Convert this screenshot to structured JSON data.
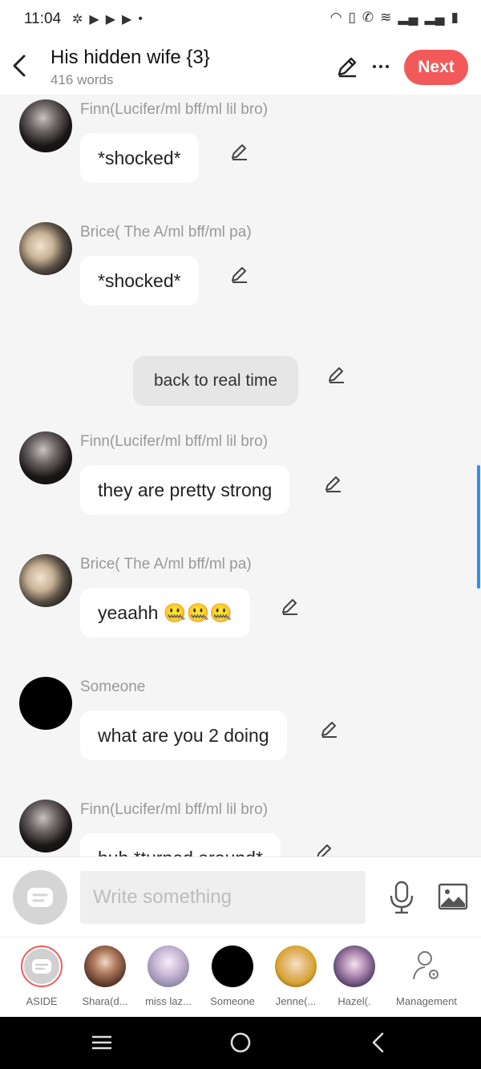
{
  "status_bar": {
    "time": "11:04"
  },
  "header": {
    "title": "His hidden wife {3}",
    "subtitle": "416 words",
    "next_label": "Next"
  },
  "messages": [
    {
      "sender": "Finn(Lucifer/ml bff/ml lil bro)",
      "text": "*shocked*"
    },
    {
      "sender": "Brice( The A/ml bff/ml pa)",
      "text": "*shocked*"
    },
    {
      "narration": "back to real time"
    },
    {
      "sender": "Finn(Lucifer/ml bff/ml lil bro)",
      "text": "they are pretty strong"
    },
    {
      "sender": "Brice( The A/ml bff/ml pa)",
      "text": "yeaahh 🤐🤐🤐"
    },
    {
      "sender": "Someone",
      "text": "what are you 2 doing"
    },
    {
      "sender": "Finn(Lucifer/ml bff/ml lil bro)",
      "text": "huh *turned around*"
    }
  ],
  "input": {
    "placeholder": "Write something"
  },
  "characters": [
    {
      "name": "ASIDE"
    },
    {
      "name": "Shara(d..."
    },
    {
      "name": "miss laz..."
    },
    {
      "name": "Someone"
    },
    {
      "name": "Jenne(..."
    },
    {
      "name": "Hazel(."
    },
    {
      "name": "Management"
    }
  ],
  "icons": {
    "back": "chevron-left-icon",
    "edit": "pencil-icon",
    "more": "more-horizontal-icon",
    "mic": "microphone-icon",
    "image": "image-icon",
    "management": "user-settings-icon"
  },
  "colors": {
    "accent": "#f25a5a",
    "scroll_indicator": "#2d8ff0"
  }
}
